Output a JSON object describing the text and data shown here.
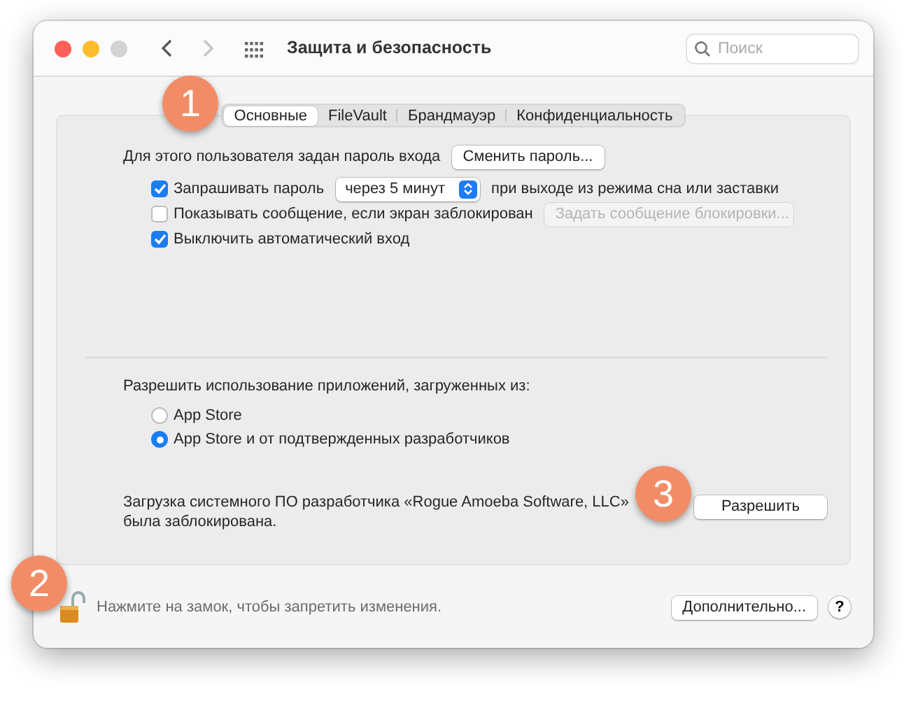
{
  "window": {
    "title": "Защита и безопасность",
    "back_enabled": true,
    "forward_enabled": false
  },
  "search": {
    "placeholder": "Поиск"
  },
  "tabs": [
    {
      "label": "Основные",
      "selected": true
    },
    {
      "label": "FileVault",
      "selected": false
    },
    {
      "label": "Брандмауэр",
      "selected": false
    },
    {
      "label": "Конфиденциальность",
      "selected": false
    }
  ],
  "password": {
    "label": "Для этого пользователя задан пароль входа",
    "button": "Сменить пароль..."
  },
  "options": [
    {
      "kind": "select",
      "label": "Запрашивать пароль",
      "checked": true,
      "select": "через 5 минут",
      "suffix": "при выходе из режима сна или заставки"
    },
    {
      "kind": "button",
      "label": "Показывать сообщение, если экран заблокирован",
      "checked": false,
      "button": "Задать сообщение блокировки...",
      "disabled": true
    },
    {
      "kind": "plain",
      "label": "Выключить автоматический вход",
      "checked": true
    }
  ],
  "apps": {
    "label": "Разрешить использование приложений, загруженных из:",
    "options": [
      {
        "label": "App Store",
        "selected": false
      },
      {
        "label": "App Store и от подтвержденных разработчиков",
        "selected": true
      }
    ]
  },
  "blocked": {
    "text": "Загрузка системного ПО разработчика «Rogue Amoeba Software, LLC» была заблокирована.",
    "button": "Разрешить"
  },
  "footer": {
    "lock_text": "Нажмите на замок, чтобы запретить изменения.",
    "locked": false,
    "advanced_button": "Дополнительно...",
    "help": "?"
  },
  "callouts": [
    {
      "label": "1"
    },
    {
      "label": "2"
    },
    {
      "label": "3"
    }
  ]
}
